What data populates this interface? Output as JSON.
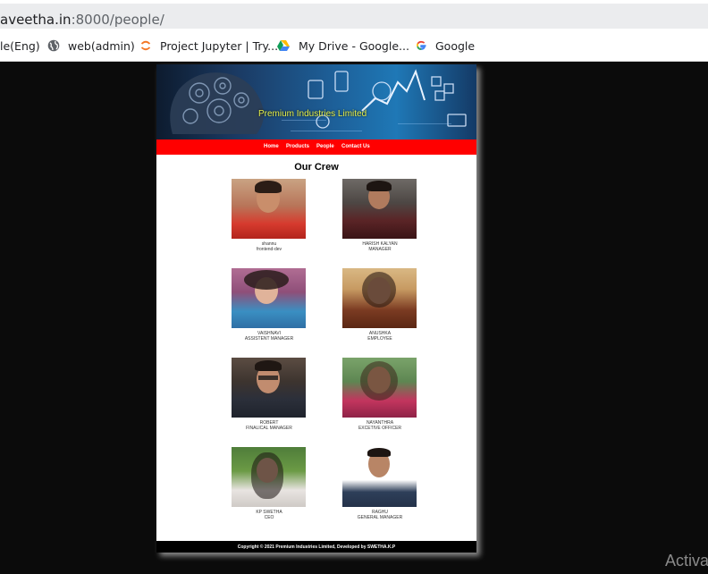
{
  "browser": {
    "url_host": "aveetha.in",
    "url_rest": ":8000/people/",
    "bookmarks": [
      {
        "label": "le(Eng)",
        "icon": "none"
      },
      {
        "label": "web(admin)",
        "icon": "globe-icon"
      },
      {
        "label": "Project Jupyter | Try...",
        "icon": "jupyter-icon"
      },
      {
        "label": "My Drive - Google...",
        "icon": "google-drive-icon"
      },
      {
        "label": "Google",
        "icon": "google-icon"
      }
    ]
  },
  "site": {
    "banner_title": "Premium Industries Limited",
    "nav": [
      "Home",
      "Products",
      "People",
      "Contact Us"
    ],
    "section_title": "Our Crew",
    "people": [
      {
        "name": "shannu",
        "role": "frontend-dev"
      },
      {
        "name": "HARISH KALYAN",
        "role": "MANAGER"
      },
      {
        "name": "VAISHNAVI",
        "role": "ASSISTENT MANAGER"
      },
      {
        "name": "ANUSHKA",
        "role": "EMPLOYEE"
      },
      {
        "name": "ROBERT",
        "role": "FINALICAL MANAGER"
      },
      {
        "name": "NAYANTHRA",
        "role": "EXCETIVE OFFICER"
      },
      {
        "name": "KP SWETHA",
        "role": "CEO"
      },
      {
        "name": "RAGHU",
        "role": "GENERAL MANAGER"
      }
    ],
    "footer": "Copyright © 2021 Premium Industries Limited, Developed by SWETHA.K.P"
  },
  "os": {
    "watermark": "Activa"
  },
  "colors": {
    "nav_bg": "#ff0000",
    "banner_title": "#e8f24a",
    "footer_bg": "#000000",
    "desktop_bg": "#0b0b0b"
  }
}
